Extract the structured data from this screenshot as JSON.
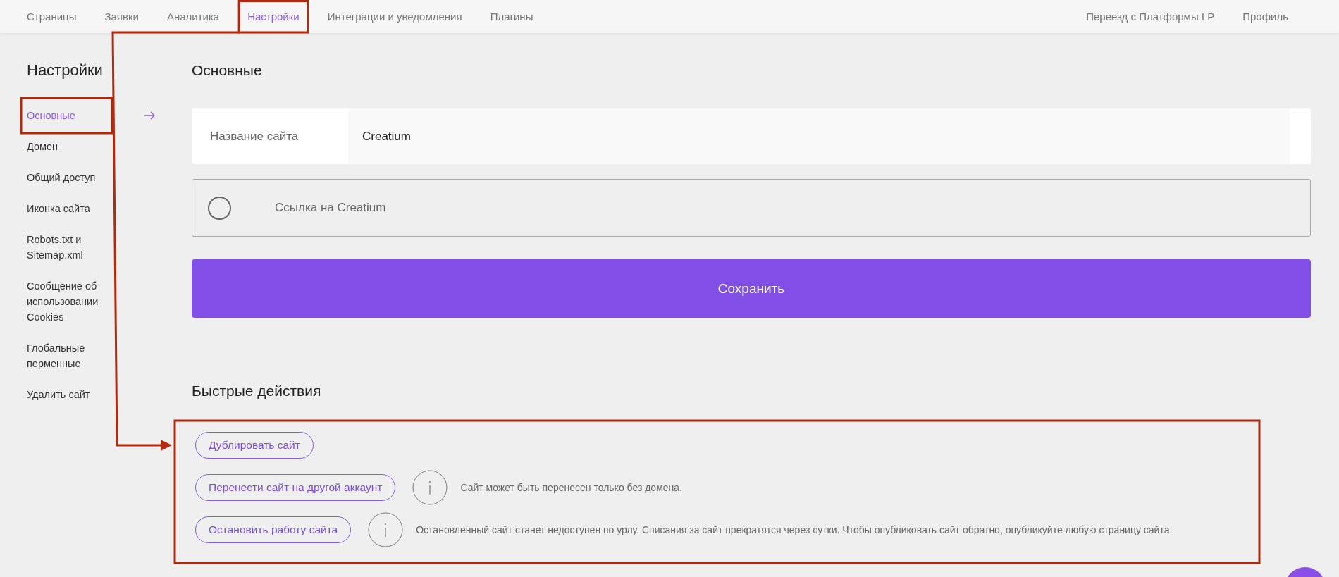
{
  "top_nav": {
    "left": [
      {
        "label": "Страницы",
        "selected": false
      },
      {
        "label": "Заявки",
        "selected": false
      },
      {
        "label": "Аналитика",
        "selected": false
      },
      {
        "label": "Настройки",
        "selected": true
      },
      {
        "label": "Интеграции и уведомления",
        "selected": false
      },
      {
        "label": "Плагины",
        "selected": false
      }
    ],
    "right": [
      {
        "label": "Переезд с Платформы LP"
      },
      {
        "label": "Профиль"
      }
    ]
  },
  "sidebar": {
    "title": "Настройки",
    "items": [
      {
        "label": "Основные",
        "selected": true
      },
      {
        "label": "Домен",
        "selected": false
      },
      {
        "label": "Общий доступ",
        "selected": false
      },
      {
        "label": "Иконка сайта",
        "selected": false
      },
      {
        "label": "Robots.txt и Sitemap.xml",
        "selected": false
      },
      {
        "label": "Сообщение об использовании Cookies",
        "selected": false
      },
      {
        "label": "Глобальные перменные",
        "selected": false
      },
      {
        "label": "Удалить сайт",
        "selected": false
      }
    ]
  },
  "main": {
    "title": "Основные",
    "site_name_field": {
      "label": "Название сайта",
      "value": "Creatium"
    },
    "link_option": {
      "label": "Ссылка на Creatium",
      "checked": false
    },
    "save_button": "Сохранить"
  },
  "quick_actions": {
    "title": "Быстрые действия",
    "actions": [
      {
        "label": "Дублировать сайт"
      },
      {
        "label": "Перенести сайт на другой аккаунт",
        "note": "Сайт может быть перенесен только без домена."
      },
      {
        "label": "Остановить работу сайта",
        "note": "Остановленный сайт станет недоступен по урлу. Списания за сайт прекратятся через сутки. Чтобы опубликовать сайт обратно, опубликуйте любую страницу сайта."
      }
    ]
  }
}
